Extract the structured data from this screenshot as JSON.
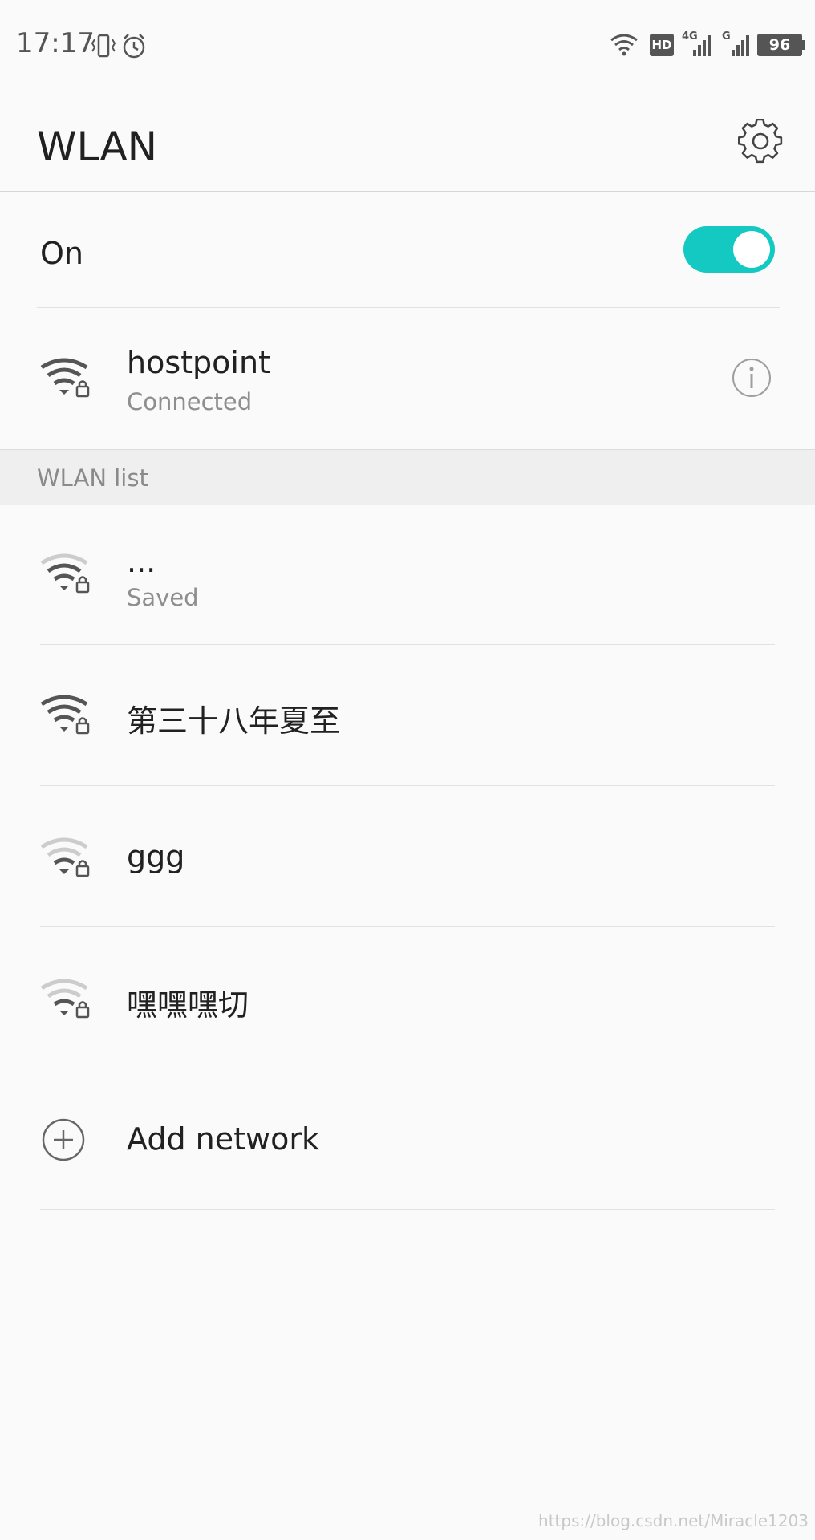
{
  "status_bar": {
    "time": "17:17",
    "battery": "96",
    "hd_label": "HD",
    "net1": "4G",
    "net2": "G",
    "icons": [
      "vibrate-icon",
      "alarm-icon",
      "wifi-icon",
      "hd-icon",
      "signal-4g-icon",
      "signal-g-icon",
      "battery-icon"
    ]
  },
  "header": {
    "title": "WLAN",
    "settings_icon": "gear-icon"
  },
  "toggle": {
    "label": "On",
    "state": true,
    "accent": "#14c9c2"
  },
  "connected": {
    "ssid": "hostpoint",
    "status": "Connected"
  },
  "section_label": "WLAN list",
  "networks": [
    {
      "ssid": "...",
      "status": "Saved"
    },
    {
      "ssid": "第三十八年夏至"
    },
    {
      "ssid": "ggg"
    },
    {
      "ssid": "嘿嘿嘿切"
    }
  ],
  "add_network": "Add network",
  "watermark": "https://blog.csdn.net/Miracle1203"
}
